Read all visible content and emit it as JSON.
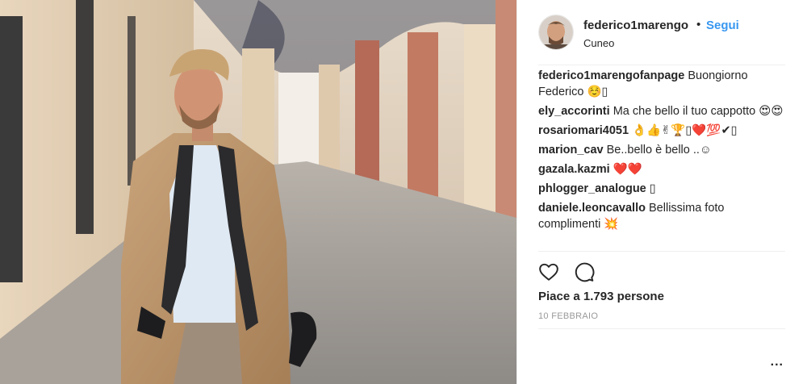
{
  "post": {
    "username": "federico1marengo",
    "separator": "•",
    "follow_label": "Segui",
    "location": "Cuneo",
    "likes_text": "Piace a 1.793 persone",
    "date": "10 FEBBRAIO",
    "more_label": "..."
  },
  "comments": [
    {
      "user": "federico1marengofanpage",
      "text": "Buongiorno Federico ☺️▯"
    },
    {
      "user": "ely_accorinti",
      "text": "Ma che bello il tuo cappotto 😍😍"
    },
    {
      "user": "rosariomari4051",
      "text": "👌👍✌🏆▯❤️💯✔▯"
    },
    {
      "user": "marion_cav",
      "text": "Be..bello è bello ..☺"
    },
    {
      "user": "gazala.kazmi",
      "text": "❤️❤️"
    },
    {
      "user": "phlogger_analogue",
      "text": "▯"
    },
    {
      "user": "daniele.leoncavallo",
      "text": "Bellissima foto complimenti 💥"
    }
  ],
  "icons": {
    "like": "heart-icon",
    "comment": "comment-icon",
    "more": "ellipsis-icon"
  },
  "colors": {
    "follow": "#3897f0",
    "text": "#262626",
    "muted": "#999999",
    "divider": "#efefef"
  }
}
